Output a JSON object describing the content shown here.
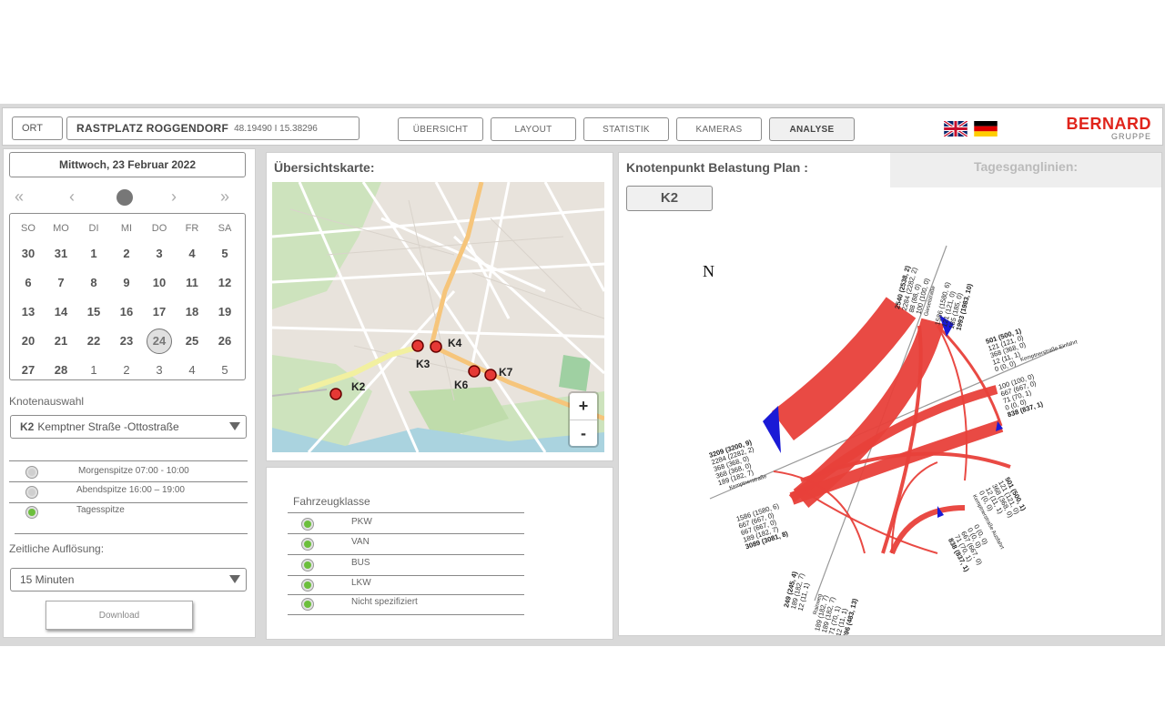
{
  "topbar": {
    "ort_label": "ORT",
    "location_name": "RASTPLATZ ROGGENDORF",
    "location_coords": "48.19490 I 15.38296",
    "nav": [
      {
        "label": "ÜBERSICHT",
        "active": false
      },
      {
        "label": "LAYOUT",
        "active": false
      },
      {
        "label": "STATISTIK",
        "active": false
      },
      {
        "label": "KAMERAS",
        "active": false
      },
      {
        "label": "ANALYSE",
        "active": true
      }
    ],
    "flags": [
      "uk-flag-icon",
      "german-flag-icon"
    ],
    "logo_name": "BERNARD",
    "logo_sub": "GRUPPE",
    "brand_color": "#e0241b"
  },
  "calendar": {
    "date_label": "Mittwoch, 23 Februar 2022",
    "nav_icons": [
      "double-chevron-left-icon",
      "chevron-left-icon",
      "today-dot-icon",
      "chevron-right-icon",
      "double-chevron-right-icon"
    ],
    "weekdays": [
      "SO",
      "MO",
      "DI",
      "MI",
      "DO",
      "FR",
      "SA"
    ],
    "weeks": [
      [
        "30",
        "31",
        "1",
        "2",
        "3",
        "4",
        "5"
      ],
      [
        "6",
        "7",
        "8",
        "9",
        "10",
        "11",
        "12"
      ],
      [
        "13",
        "14",
        "15",
        "16",
        "17",
        "18",
        "19"
      ],
      [
        "20",
        "21",
        "22",
        "23",
        "24",
        "25",
        "26"
      ],
      [
        "27",
        "28",
        "1",
        "2",
        "3",
        "4",
        "5"
      ]
    ],
    "selected": "24"
  },
  "knot_select": {
    "label": "Knotenauswahl",
    "code": "K2",
    "name": "Kemptner Straße -Ottostraße"
  },
  "peaks": [
    {
      "label": "Morgenspitze 07:00 - 10:00",
      "selected": false
    },
    {
      "label": "Abendspitze   16:00 – 19:00",
      "selected": false
    },
    {
      "label": "Tagesspitze",
      "selected": true
    }
  ],
  "resolution": {
    "label": "Zeitliche Auflösung:",
    "value": "15 Minuten"
  },
  "download_label": "Download",
  "map": {
    "title": "Übersichtskarte:",
    "nodes": [
      "K2",
      "K3",
      "K4",
      "K6",
      "K7"
    ],
    "zoom_in": "+",
    "zoom_out": "-"
  },
  "vehicle": {
    "title": "Fahrzeugklasse",
    "classes": [
      {
        "label": "PKW",
        "selected": true
      },
      {
        "label": "VAN",
        "selected": true
      },
      {
        "label": "BUS",
        "selected": true
      },
      {
        "label": "LKW",
        "selected": true
      },
      {
        "label": "Nicht spezifiziert",
        "selected": true
      }
    ]
  },
  "knot_panel": {
    "title": "Knotenpunkt Belastung Plan :",
    "tab_inactive": "Tagesganglinien:",
    "node_button": "K2",
    "north": "N",
    "flow_color": "#e8403a",
    "arm_labels": {
      "top": [
        "2540 (2538, 2)",
        "2284 (2282, 2)",
        "88 (88, 0)",
        "100 (100, 0)",
        "Gieselstraße"
      ],
      "top_out": [
        "1586 (1580, 6)",
        "121 (121, 0)",
        "185 (185, 0)",
        "1993 (1983, 10)"
      ],
      "right_top": [
        "501 (500, 1)",
        "121 (121, 0)",
        "368 (368, 0)",
        "12 (11, 1)",
        "0 (0, 0)",
        "Kemptnerstraße Einfahrt"
      ],
      "right_mid": [
        "100 (100, 0)",
        "667 (667, 0)",
        "71 (70, 1)",
        "0 (0, 0)",
        "838 (837, 1)"
      ],
      "right_low": [
        "501 (500, 1)",
        "121 (121, 0)",
        "368 (368, 0)",
        "12 (11, 1)",
        "0 (0, 0)",
        "Kemptnerstraße Ausfahrt"
      ],
      "right_bot": [
        "0 (0, 0)",
        "0 (0, 0)",
        "667 (667, 0)",
        "71 (70, 1)",
        "838 (837, 1)"
      ],
      "left": [
        "3209 (3200, 9)",
        "2284 (2282, 2)",
        "368 (368, 0)",
        "368 (368, 0)",
        "189 (182, 7)",
        "Kemptnerstraße"
      ],
      "left_low": [
        "1586 (1580, 6)",
        "667 (667, 0)",
        "667 (667, 0)",
        "189 (182, 7)",
        "3089 (3081, 8)"
      ],
      "bottom": [
        "249 (245, 4)",
        "189 (182, 7)",
        "12 (11, 1)",
        "Rainweg"
      ],
      "bottom_out": [
        "189 (182, 7)",
        "189 (182, 7)",
        "71 (70, 1)",
        "12 (11, 1)",
        "496 (483, 13)"
      ]
    }
  }
}
